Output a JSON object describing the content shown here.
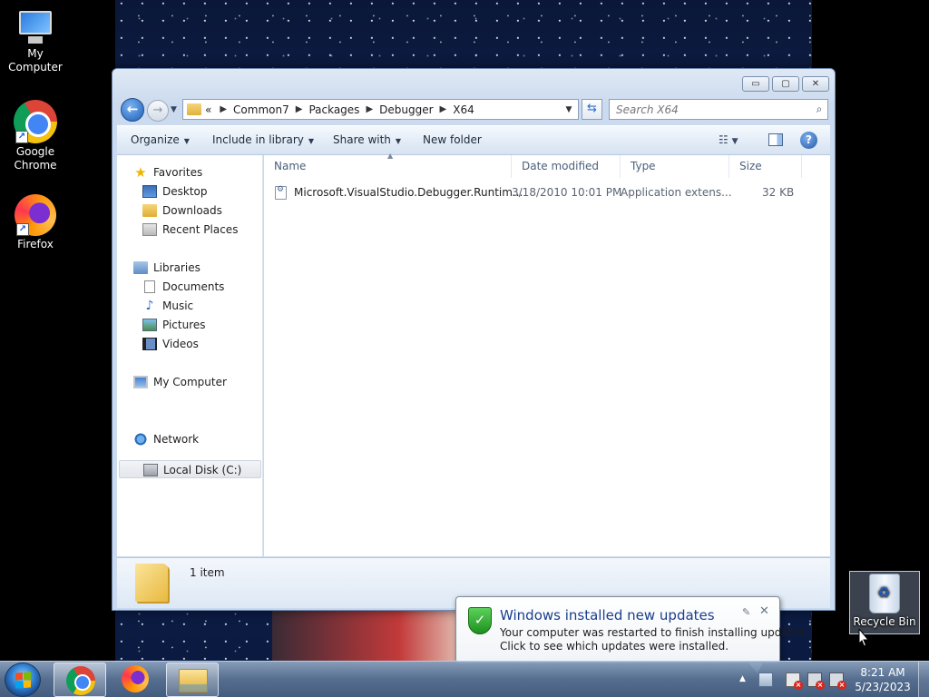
{
  "desktop": {
    "icons": [
      {
        "label": "My Computer",
        "icon": "computer-icon"
      },
      {
        "label": "Google Chrome",
        "icon": "chrome-icon"
      },
      {
        "label": "Firefox",
        "icon": "firefox-icon"
      },
      {
        "label": "Recycle Bin",
        "icon": "recycle-bin-icon"
      }
    ]
  },
  "explorer": {
    "title_buttons": {
      "minimize": "▭",
      "maximize": "▢",
      "close": "✕"
    },
    "address": {
      "overflow": "«",
      "crumbs": [
        "Common7",
        "Packages",
        "Debugger",
        "X64"
      ],
      "separator": "▶"
    },
    "search": {
      "placeholder": "Search X64"
    },
    "command_bar": {
      "organize": "Organize",
      "include_in_library": "Include in library",
      "share_with": "Share with",
      "new_folder": "New folder"
    },
    "nav": {
      "favorites": "Favorites",
      "desktop": "Desktop",
      "downloads": "Downloads",
      "recent_places": "Recent Places",
      "libraries": "Libraries",
      "documents": "Documents",
      "music": "Music",
      "pictures": "Pictures",
      "videos": "Videos",
      "my_computer": "My Computer",
      "local_disk": "Local Disk (C:)",
      "network": "Network"
    },
    "columns": {
      "name": "Name",
      "date_modified": "Date modified",
      "type": "Type",
      "size": "Size"
    },
    "files": [
      {
        "name": "Microsoft.VisualStudio.Debugger.Runtim...",
        "date_modified": "3/18/2010 10:01 PM",
        "type": "Application extens...",
        "size": "32 KB"
      }
    ],
    "details": {
      "item_count": "1 item"
    }
  },
  "notification": {
    "title": "Windows installed new updates",
    "line1": "Your computer was restarted to finish installing updates.",
    "line2": "Click to see which updates were installed.",
    "close": "✕"
  },
  "taskbar": {
    "clock_time": "8:21 AM",
    "clock_date": "5/23/2023"
  }
}
